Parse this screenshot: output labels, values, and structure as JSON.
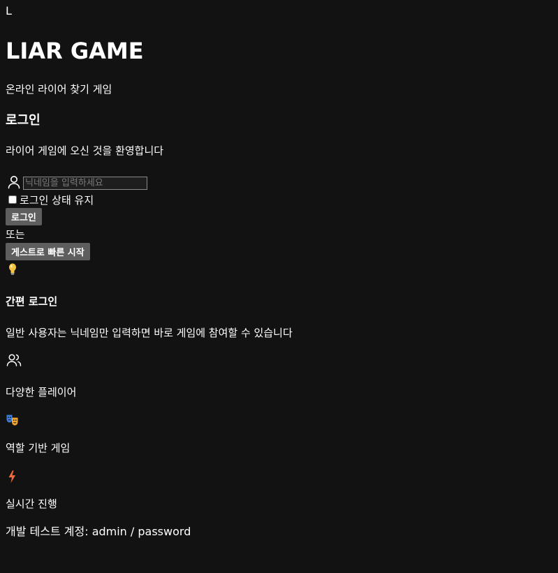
{
  "header": {
    "logo_letter": "L",
    "title": "LIAR GAME",
    "subtitle": "온라인 라이어 찾기 게임"
  },
  "login": {
    "heading": "로그인",
    "welcome": "라이어 게임에 오신 것을 환영합니다",
    "nickname_placeholder": "닉네임을 입력하세요",
    "nickname_value": "",
    "remember_label": "로그인 상태 유지",
    "remember_checked": false,
    "login_button": "로그인",
    "or_text": "또는",
    "guest_button": "게스트로 빠른 시작"
  },
  "easy_login": {
    "icon": "lightbulb-icon",
    "heading": "간편 로그인",
    "description": "일반 사용자는 닉네임만 입력하면 바로 게임에 참여할 수 있습니다"
  },
  "features": [
    {
      "icon": "users-icon",
      "label": "다양한 플레이어"
    },
    {
      "icon": "theater-masks-icon",
      "label": "역할 기반 게임"
    },
    {
      "icon": "lightning-icon",
      "label": "실시간 진행"
    }
  ],
  "footer": {
    "dev_account": "개발 테스트 계정: admin / password"
  },
  "colors": {
    "background": "#121212",
    "text": "#ffffff",
    "button_bg": "#5e5e5e",
    "bolt": "#f06a3a",
    "bulb": "#f5c542"
  }
}
